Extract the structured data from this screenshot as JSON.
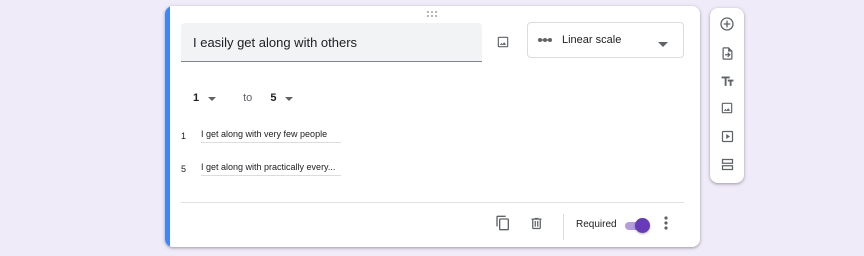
{
  "question": {
    "title": "I easily get along with others",
    "type_select": {
      "selected": "Linear scale",
      "icon": "linear-scale-icon"
    }
  },
  "scale": {
    "min": "1",
    "to_label": "to",
    "max": "5"
  },
  "labels": [
    {
      "num": "1",
      "text": "I get along with very few people"
    },
    {
      "num": "5",
      "text": "I get along with practically every..."
    }
  ],
  "footer": {
    "required_label": "Required",
    "required_on": true
  },
  "toolbar": {
    "items": [
      "add-question-icon",
      "import-questions-icon",
      "add-title-icon",
      "add-image-icon",
      "add-video-icon",
      "add-section-icon"
    ]
  },
  "colors": {
    "accent_bar": "#4285f4",
    "toggle_thumb": "#673ab7",
    "toggle_track": "#b39ddb",
    "background": "#f0ebf8"
  }
}
